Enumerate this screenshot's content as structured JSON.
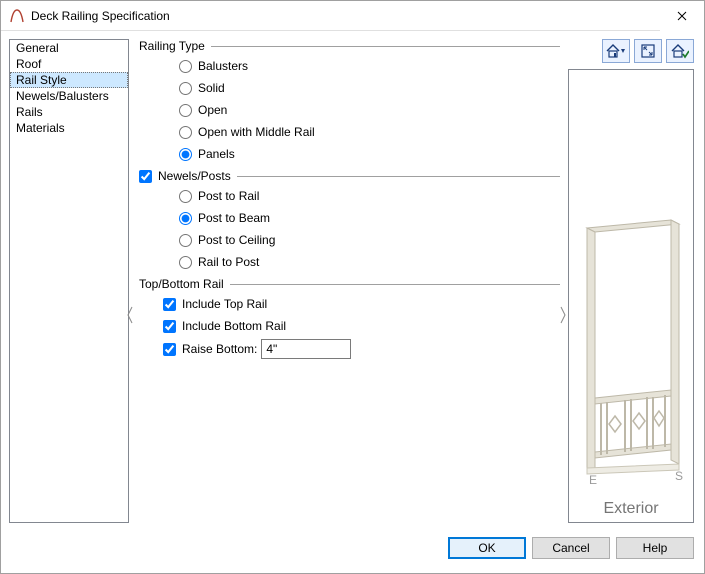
{
  "window": {
    "title": "Deck Railing Specification"
  },
  "sidebar": {
    "items": [
      {
        "label": "General"
      },
      {
        "label": "Roof"
      },
      {
        "label": "Rail Style"
      },
      {
        "label": "Newels/Balusters"
      },
      {
        "label": "Rails"
      },
      {
        "label": "Materials"
      }
    ],
    "selected_index": 2
  },
  "groups": {
    "railing_type": {
      "title": "Railing Type",
      "options": [
        {
          "label": "Balusters",
          "checked": false
        },
        {
          "label": "Solid",
          "checked": false
        },
        {
          "label": "Open",
          "checked": false
        },
        {
          "label": "Open with Middle Rail",
          "checked": false
        },
        {
          "label": "Panels",
          "checked": true
        }
      ]
    },
    "newels": {
      "title": "Newels/Posts",
      "group_checked": true,
      "options": [
        {
          "label": "Post to Rail",
          "checked": false
        },
        {
          "label": "Post to Beam",
          "checked": true
        },
        {
          "label": "Post to Ceiling",
          "checked": false
        },
        {
          "label": "Rail to Post",
          "checked": false
        }
      ]
    },
    "top_bottom": {
      "title": "Top/Bottom Rail",
      "include_top": {
        "label": "Include Top Rail",
        "checked": true
      },
      "include_bottom": {
        "label": "Include Bottom Rail",
        "checked": true
      },
      "raise_bottom": {
        "label": "Raise Bottom:",
        "checked": true,
        "value": "4\""
      }
    }
  },
  "preview": {
    "label": "Exterior",
    "corner_e": "E",
    "corner_s": "S"
  },
  "tool_icons": {
    "home": "home-dropdown-icon",
    "expand": "expand-icon",
    "rotate": "home-check-icon"
  },
  "buttons": {
    "ok": "OK",
    "cancel": "Cancel",
    "help": "Help"
  }
}
